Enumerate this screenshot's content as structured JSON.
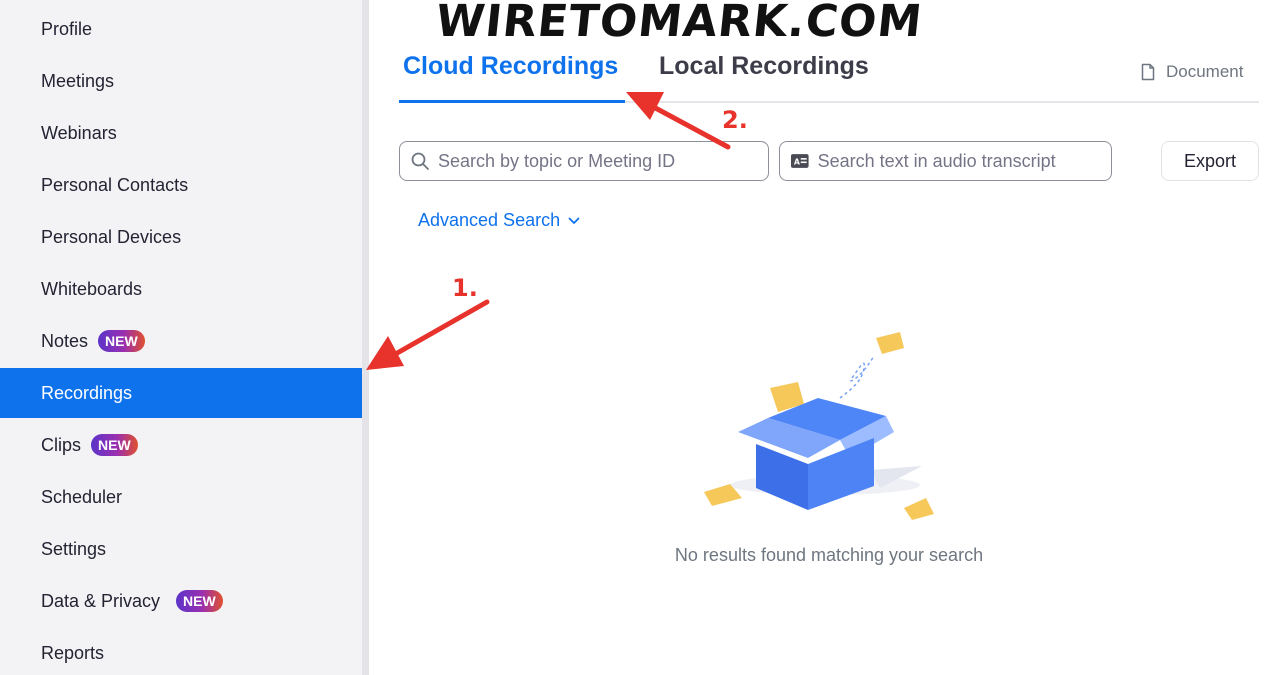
{
  "watermark": "WIRETOMARK.COM",
  "sidebar": {
    "items": [
      {
        "label": "Profile"
      },
      {
        "label": "Meetings"
      },
      {
        "label": "Webinars"
      },
      {
        "label": "Personal Contacts"
      },
      {
        "label": "Personal Devices"
      },
      {
        "label": "Whiteboards"
      },
      {
        "label": "Notes",
        "badge": "NEW"
      },
      {
        "label": "Recordings",
        "active": true
      },
      {
        "label": "Clips",
        "badge": "NEW"
      },
      {
        "label": "Scheduler"
      },
      {
        "label": "Settings"
      },
      {
        "label": "Data & Privacy",
        "badge": "NEW"
      },
      {
        "label": "Reports"
      }
    ]
  },
  "tabs": [
    {
      "label": "Cloud Recordings",
      "active": true
    },
    {
      "label": "Local Recordings",
      "active": false
    }
  ],
  "document_link": {
    "label": "Document",
    "icon": "document-icon"
  },
  "search": {
    "topic_placeholder": "Search by topic or Meeting ID",
    "transcript_placeholder": "Search text in audio transcript"
  },
  "export_label": "Export",
  "advanced_search_label": "Advanced Search",
  "empty_state": {
    "message": "No results found matching your search"
  },
  "annotations": {
    "step1": "1.",
    "step2": "2."
  },
  "colors": {
    "accent": "#0e72ed",
    "annotation": "#e8322c",
    "sidebar_bg": "#f3f3f5"
  }
}
